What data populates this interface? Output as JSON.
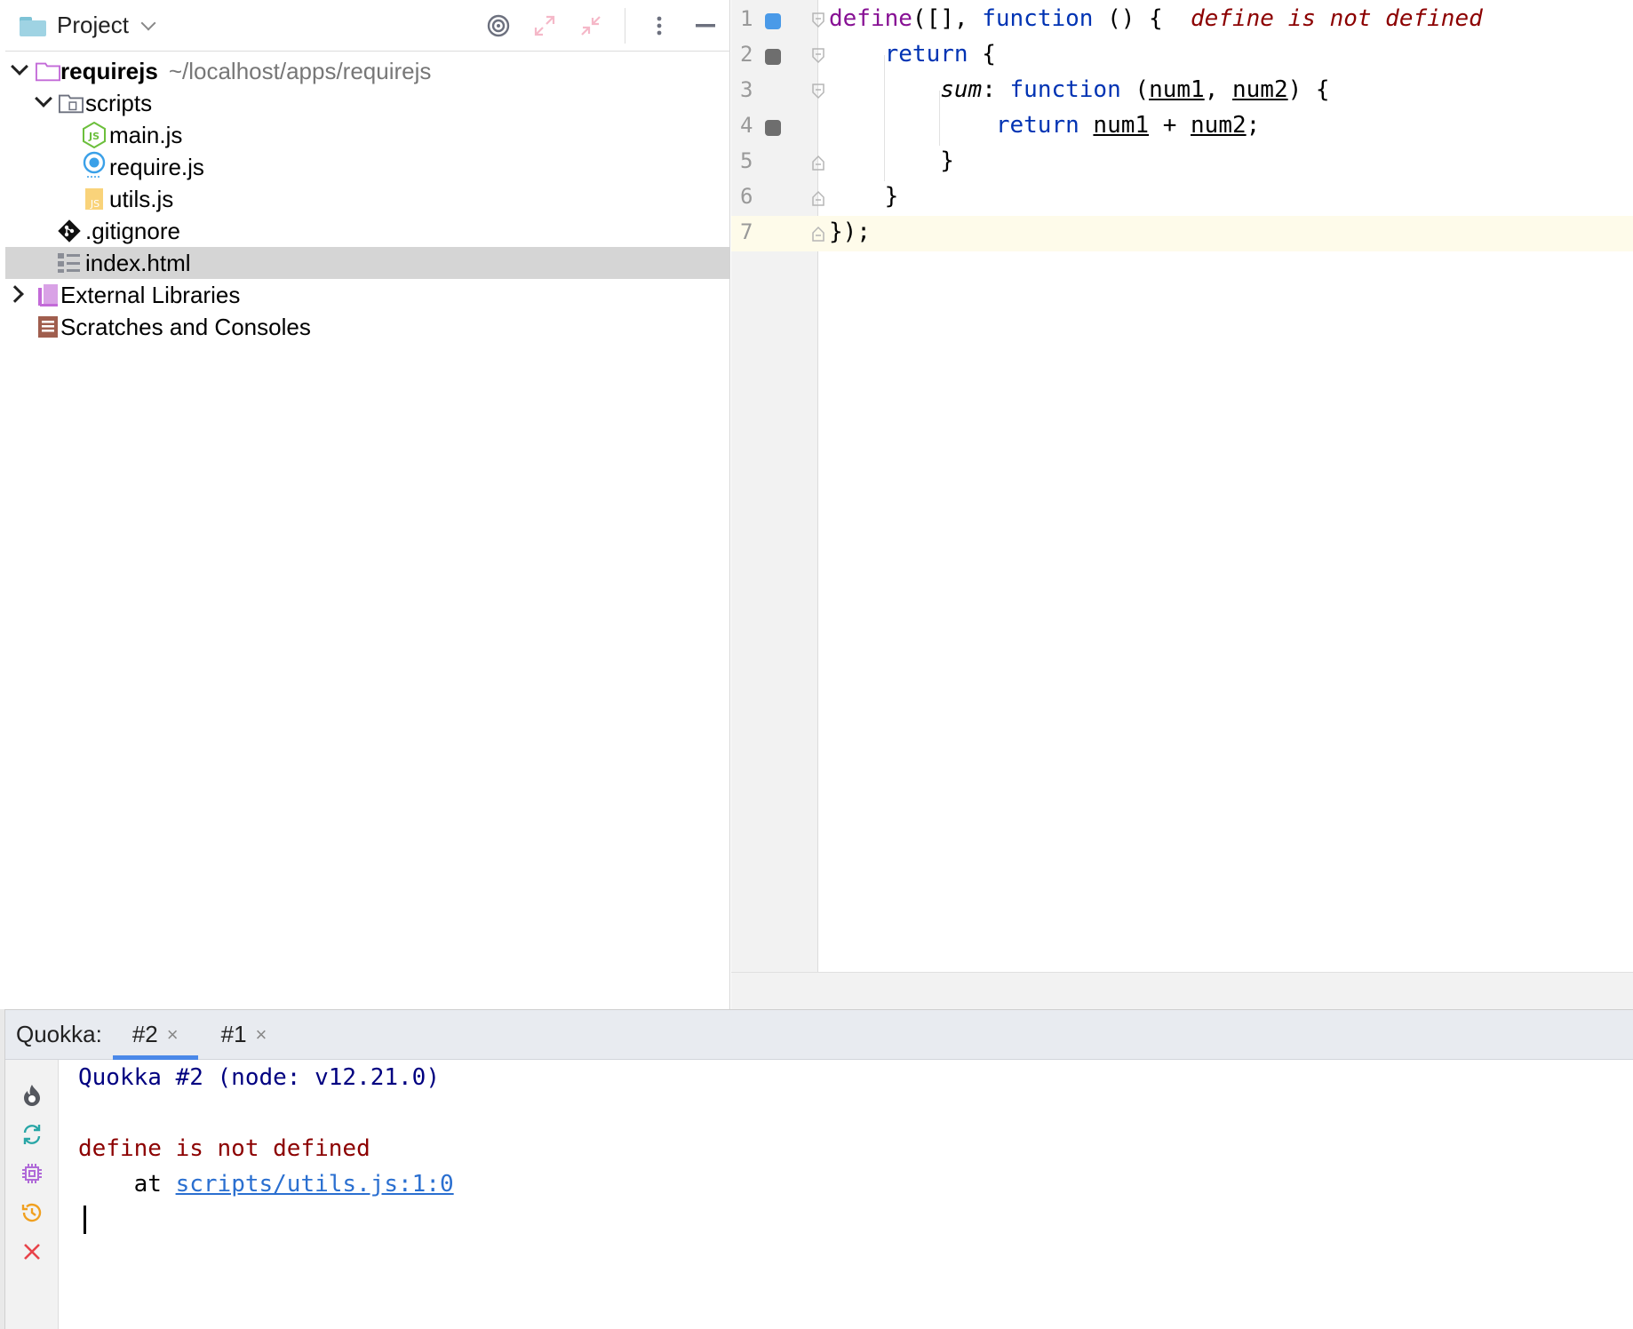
{
  "project_panel": {
    "title": "Project",
    "tree": {
      "root": {
        "name": "requirejs",
        "path": "~/localhost/apps/requirejs"
      },
      "scripts_folder": "scripts",
      "files": [
        "main.js",
        "require.js",
        "utils.js"
      ],
      "gitignore": ".gitignore",
      "index": "index.html",
      "external_libraries": "External Libraries",
      "scratches": "Scratches and Consoles"
    }
  },
  "editor": {
    "line_numbers": [
      "1",
      "2",
      "3",
      "4",
      "5",
      "6",
      "7"
    ],
    "lines": {
      "l1": {
        "fn": "define",
        "mid": "([], ",
        "kw": "function",
        "tail": " () {",
        "error": "define is not defined"
      },
      "l2": {
        "kw": "return",
        "tail": " {"
      },
      "l3": {
        "prop": "sum",
        "colon": ": ",
        "kw": "function",
        "open": " (",
        "p1": "num1",
        "comma": ", ",
        "p2": "num2",
        "tail": ") {"
      },
      "l4": {
        "kw": "return",
        "p1": "num1",
        "op": " + ",
        "p2": "num2",
        "semi": ";"
      },
      "l5": {
        "text": "}"
      },
      "l6": {
        "text": "}"
      },
      "l7": {
        "text": "});"
      }
    },
    "colors": {
      "function_name": "#871094",
      "keyword": "#0033b3",
      "error": "#8c0000",
      "breakpoint_active": "#4a9ae8",
      "breakpoint_inactive": "#6e6e6e"
    }
  },
  "quokka": {
    "title": "Quokka:",
    "tabs": [
      {
        "label": "#2",
        "active": true
      },
      {
        "label": "#1",
        "active": false
      }
    ],
    "close_glyph": "×",
    "output": {
      "header": "Quokka #2 (node: v12.21.0)",
      "error": "define is not defined",
      "at_prefix": "    at ",
      "link": "scripts/utils.js:1:0"
    },
    "side_icons": [
      "flame-icon",
      "refresh-icon",
      "chip-icon",
      "history-icon",
      "close-icon"
    ]
  }
}
